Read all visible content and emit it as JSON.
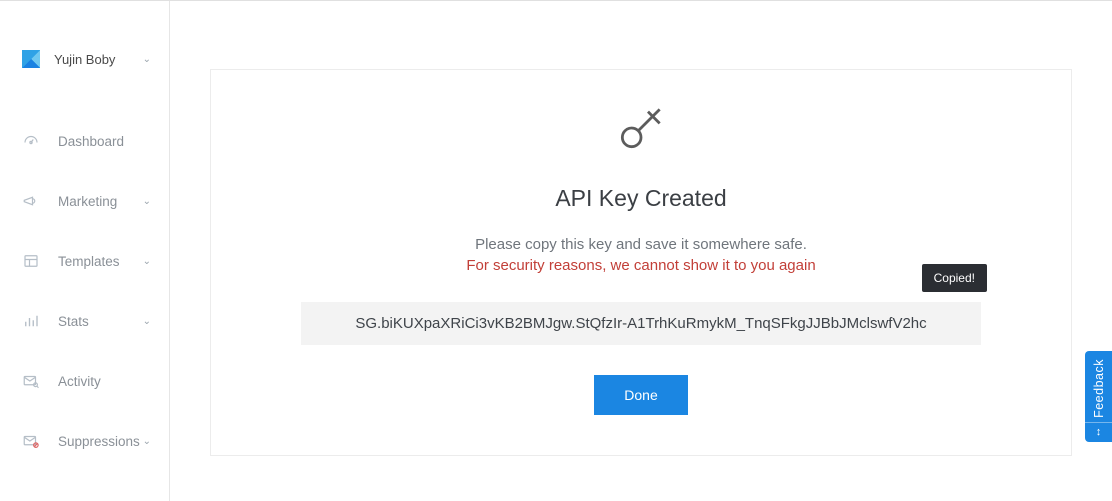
{
  "user": {
    "name": "Yujin Boby"
  },
  "nav": [
    {
      "label": "Dashboard",
      "chev": false
    },
    {
      "label": "Marketing",
      "chev": true
    },
    {
      "label": "Templates",
      "chev": true
    },
    {
      "label": "Stats",
      "chev": true
    },
    {
      "label": "Activity",
      "chev": false
    },
    {
      "label": "Suppressions",
      "chev": true
    }
  ],
  "card": {
    "title": "API Key Created",
    "instruction": "Please copy this key and save it somewhere safe.",
    "warning": "For security reasons, we cannot show it to you again",
    "key_value": "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",
    "copied_tooltip": "Copied!",
    "done_label": "Done"
  },
  "feedback": {
    "label": "Feedback"
  }
}
